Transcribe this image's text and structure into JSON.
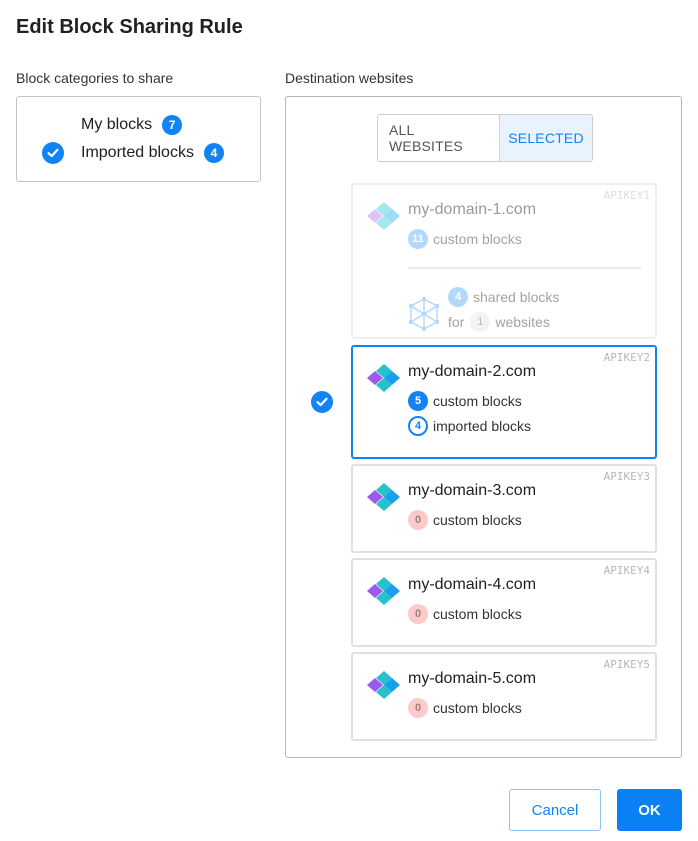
{
  "dialog": {
    "title": "Edit Block Sharing Rule"
  },
  "categories": {
    "label": "Block categories to share",
    "items": [
      {
        "label": "My blocks",
        "count": "7",
        "checked": false
      },
      {
        "label": "Imported blocks",
        "count": "4",
        "checked": true
      }
    ]
  },
  "destinations": {
    "label": "Destination websites",
    "toggle": {
      "all_label": "ALL WEBSITES",
      "selected_label": "SELECTED",
      "active": "SELECTED"
    },
    "sites": [
      {
        "apikey": "APIKEY1",
        "domain": "my-domain-1.com",
        "custom_count": "11",
        "custom_label": "custom blocks",
        "shared_count": "4",
        "shared_label": "shared blocks",
        "for_label": "for",
        "websites_count": "1",
        "websites_label": "websites",
        "state": "disabled"
      },
      {
        "apikey": "APIKEY2",
        "domain": "my-domain-2.com",
        "custom_count": "5",
        "custom_label": "custom blocks",
        "imported_count": "4",
        "imported_label": "imported blocks",
        "state": "selected"
      },
      {
        "apikey": "APIKEY3",
        "domain": "my-domain-3.com",
        "custom_count": "0",
        "custom_label": "custom blocks",
        "state": "unselected"
      },
      {
        "apikey": "APIKEY4",
        "domain": "my-domain-4.com",
        "custom_count": "0",
        "custom_label": "custom blocks",
        "state": "unselected"
      },
      {
        "apikey": "APIKEY5",
        "domain": "my-domain-5.com",
        "custom_count": "0",
        "custom_label": "custom blocks",
        "state": "unselected"
      }
    ]
  },
  "footer": {
    "cancel_label": "Cancel",
    "ok_label": "OK"
  },
  "colors": {
    "accent": "#1283f4",
    "zero_badge": "#fdcaca",
    "selected_toggle_bg": "#e8f3fe"
  }
}
